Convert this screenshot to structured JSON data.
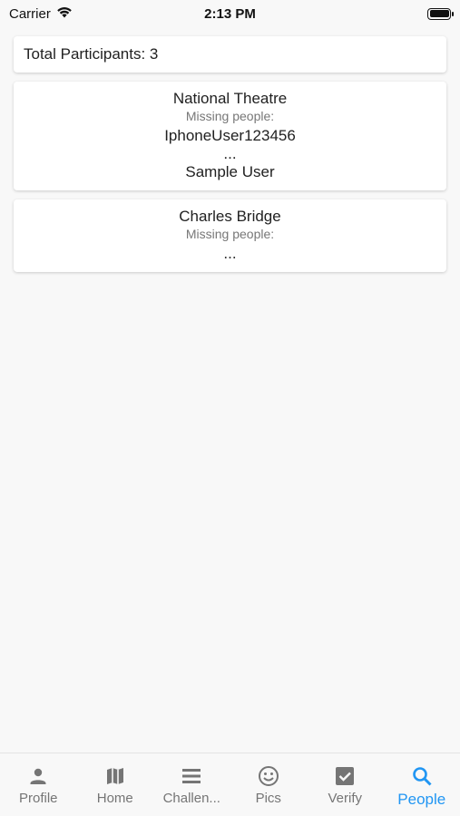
{
  "status_bar": {
    "carrier": "Carrier",
    "time": "2:13 PM"
  },
  "total_participants": "Total Participants: 3",
  "challenges": [
    {
      "title": "National Theatre",
      "missing_label": "Missing people:",
      "people": [
        "IphoneUser123456",
        "...",
        "Sample User"
      ]
    },
    {
      "title": "Charles Bridge",
      "missing_label": "Missing people:",
      "people": [
        "..."
      ]
    }
  ],
  "nav": {
    "items": [
      {
        "label": "Profile",
        "icon": "person-icon"
      },
      {
        "label": "Home",
        "icon": "map-icon"
      },
      {
        "label": "Challen...",
        "icon": "list-icon"
      },
      {
        "label": "Pics",
        "icon": "smiley-icon"
      },
      {
        "label": "Verify",
        "icon": "checkbox-icon"
      },
      {
        "label": "People",
        "icon": "search-icon"
      }
    ],
    "active_index": 5,
    "active_color": "#2196f3",
    "inactive_color": "#757575"
  }
}
